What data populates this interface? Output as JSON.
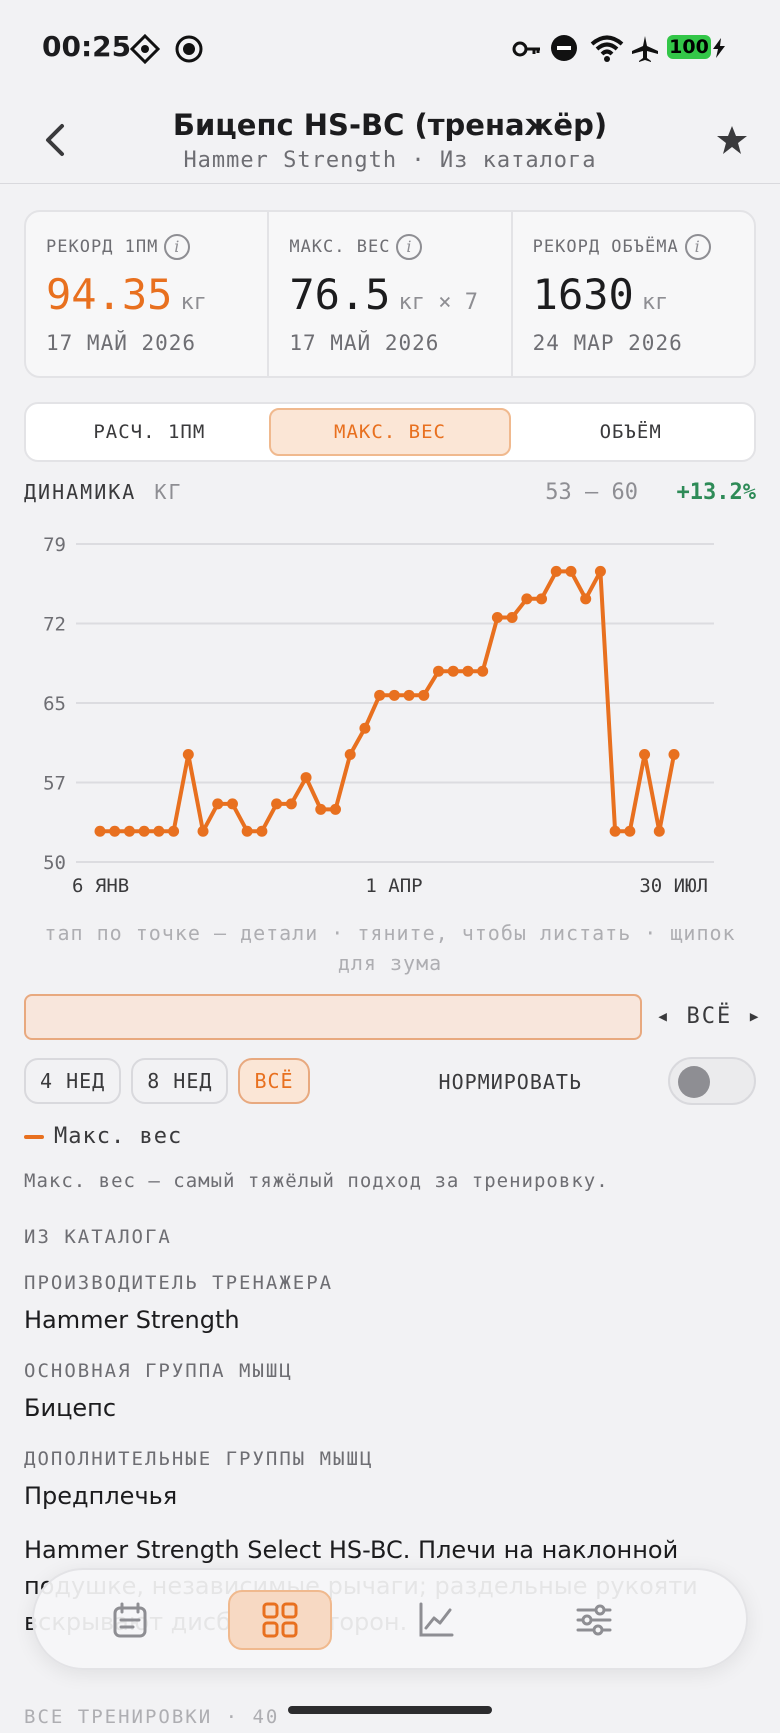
{
  "status": {
    "time": "00:25",
    "battery": "100"
  },
  "nav": {
    "title": "Бицепс HS-BC (тренажёр)",
    "subtitle": "Hammer Strength · Из каталога"
  },
  "stats": [
    {
      "label": "РЕКОРД 1ПМ",
      "value": "94.35",
      "unit": "кг",
      "date": "17 МАЙ 2026"
    },
    {
      "label": "МАКС. ВЕС",
      "value": "76.5",
      "unit": "кг × 7",
      "date": "17 МАЙ 2026"
    },
    {
      "label": "РЕКОРД ОБЪЁМА",
      "value": "1630",
      "unit": "кг",
      "date": "24 МАР 2026"
    }
  ],
  "segments": {
    "items": [
      "РАСЧ. 1ПМ",
      "МАКС. ВЕС",
      "ОБЪЁМ"
    ],
    "selected": "МАКС. ВЕС"
  },
  "dynamics": {
    "label": "ДИНАМИКА",
    "unit": "КГ",
    "range": "53 – 60",
    "delta": "+13.2%"
  },
  "chart_data": {
    "type": "line",
    "y_ticks": [
      "79",
      "72",
      "65",
      "57",
      "50"
    ],
    "x_ticks": [
      "6 ЯНВ",
      "1 АПР",
      "30 ИЮЛ"
    ],
    "ylim": [
      50,
      79
    ],
    "series": [
      {
        "name": "Макс. вес",
        "color": "#e8701f",
        "values": [
          52.8,
          52.8,
          52.8,
          52.8,
          52.8,
          52.8,
          59.8,
          52.8,
          55.3,
          55.3,
          52.8,
          52.8,
          55.3,
          55.3,
          57.7,
          54.8,
          54.8,
          59.8,
          62.2,
          65.2,
          65.2,
          65.2,
          65.2,
          67.4,
          67.4,
          67.4,
          67.4,
          72.3,
          72.3,
          74.0,
          74.0,
          76.5,
          76.5,
          74.0,
          76.5,
          52.8,
          52.8,
          59.8,
          52.8,
          59.8
        ]
      }
    ]
  },
  "hint": "тап по точке — детали · тяните, чтобы листать · щипок для зума",
  "range_nav": "◂ ВСЁ ▸",
  "chips": [
    "4 НЕД",
    "8 НЕД",
    "ВСЁ"
  ],
  "chip_selected": "ВСЁ",
  "normalize_label": "НОРМИРОВАТЬ",
  "normalize_on": false,
  "legend": "Макс. вес",
  "description": "Макс. вес — самый тяжёлый подход за тренировку.",
  "catalog": {
    "heading": "ИЗ КАТАЛОГА",
    "fields": [
      {
        "label": "ПРОИЗВОДИТЕЛЬ ТРЕНАЖЕРА",
        "value": "Hammer Strength"
      },
      {
        "label": "ОСНОВНАЯ ГРУППА МЫШЦ",
        "value": "Бицепс"
      },
      {
        "label": "ДОПОЛНИТЕЛЬНЫЕ ГРУППЫ МЫШЦ",
        "value": "Предплечья"
      }
    ],
    "notes": "Hammer Strength Select HS-BC. Плечи на наклонной подушке, независимые рычаги; раздельные рукояти вскрывают дисбаланс сторон."
  },
  "footer_heading": "ВСЕ ТРЕНИРОВКИ · 40",
  "tabs": [
    {
      "icon": "calendar-icon",
      "active": false
    },
    {
      "icon": "grid-icon",
      "active": true
    },
    {
      "icon": "chart-line-icon",
      "active": false
    },
    {
      "icon": "sliders-icon",
      "active": false
    }
  ]
}
